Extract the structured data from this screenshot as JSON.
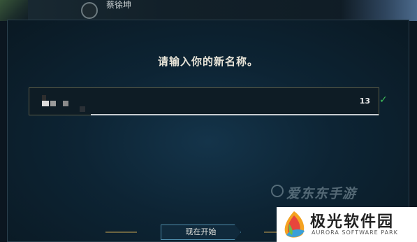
{
  "background": {
    "player_name": "蔡徐坤"
  },
  "dialog": {
    "title": "请输入你的新名称。",
    "name_input": {
      "char_count": "13"
    },
    "start_button_label": "现在开始",
    "confirm_icon": "check-icon"
  },
  "watermarks": {
    "top_text": "爱东东手游",
    "brand_cn": "极光软件园",
    "brand_en": "AURORA SOFTWARE PARK"
  },
  "colors": {
    "accent_green": "#3fbf5a",
    "button_border": "#4d8aa8",
    "title_text": "#e8e4d8"
  }
}
